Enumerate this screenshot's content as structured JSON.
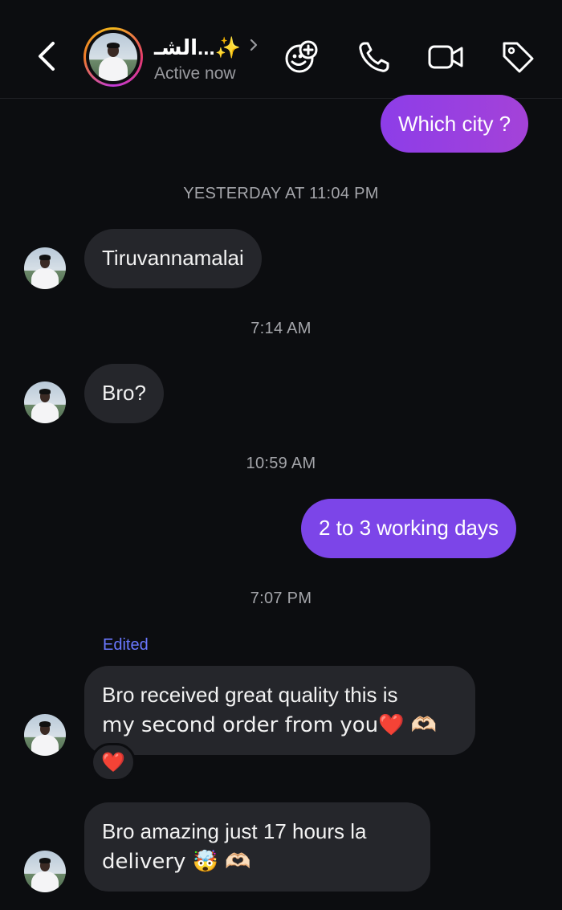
{
  "header": {
    "contact_name": "الشـ...✨",
    "status": "Active now",
    "icons": [
      "back-chevron-icon",
      "add-game-icon",
      "phone-icon",
      "video-icon",
      "tag-icon"
    ]
  },
  "messages": [
    {
      "type": "out",
      "text": "Which city ?"
    },
    {
      "type": "timestamp",
      "text": "YESTERDAY AT 11:04 PM"
    },
    {
      "type": "in",
      "text": "Tiruvannamalai"
    },
    {
      "type": "timestamp",
      "text": "7:14 AM"
    },
    {
      "type": "in",
      "text": "Bro?"
    },
    {
      "type": "timestamp",
      "text": "10:59 AM"
    },
    {
      "type": "out",
      "text": "2 to 3 working days"
    },
    {
      "type": "timestamp",
      "text": "7:07 PM"
    },
    {
      "type": "label",
      "text": "Edited"
    },
    {
      "type": "in",
      "line1": "Bro received great quality this is",
      "line2": "my second order from you❤️ 🫶🏻",
      "reaction": "❤️"
    },
    {
      "type": "in",
      "line1": "Bro amazing just 17 hours la",
      "line2": "delivery 🤯 🫶🏻"
    }
  ],
  "colors": {
    "background": "#0c0d10",
    "outgoing_bubble": "#8d3de8",
    "incoming_bubble": "#25262b",
    "edited_label": "#6a78ff"
  }
}
